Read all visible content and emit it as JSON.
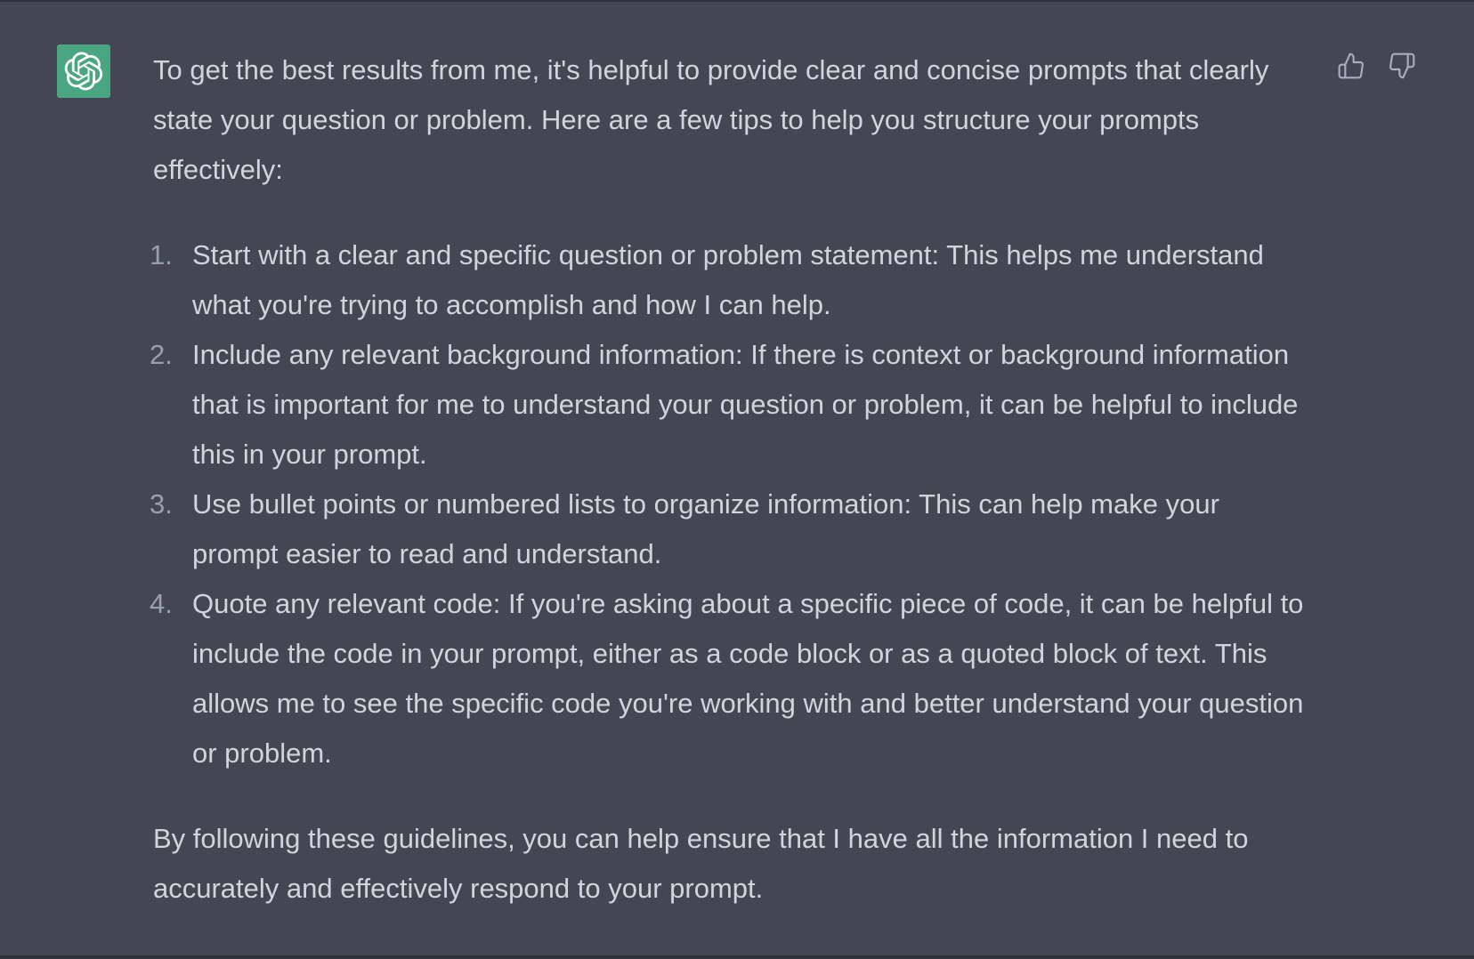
{
  "conversation": {
    "assistant": {
      "avatar_icon": "openai-logo-icon",
      "avatar_color": "#4aa582",
      "intro": "To get the best results from me, it's helpful to provide clear and concise prompts that clearly state your question or problem. Here are a few tips to help you structure your prompts effectively:",
      "tips": [
        {
          "number": "1.",
          "text": "Start with a clear and specific question or problem statement: This helps me understand what you're trying to accomplish and how I can help."
        },
        {
          "number": "2.",
          "text": "Include any relevant background information: If there is context or background information that is important for me to understand your question or problem, it can be helpful to include this in your prompt."
        },
        {
          "number": "3.",
          "text": "Use bullet points or numbered lists to organize information: This can help make your prompt easier to read and understand."
        },
        {
          "number": "4.",
          "text": "Quote any relevant code: If you're asking about a specific piece of code, it can be helpful to include the code in your prompt, either as a code block or as a quoted block of text. This allows me to see the specific code you're working with and better understand your question or problem."
        }
      ],
      "conclusion": "By following these guidelines, you can help ensure that I have all the information I need to accurately and effectively respond to your prompt."
    },
    "feedback": {
      "thumbs_up_icon": "thumbs-up-icon",
      "thumbs_down_icon": "thumbs-down-icon"
    }
  },
  "colors": {
    "background": "#444654",
    "text": "#d1d5db",
    "list_number": "#9aa0ab",
    "icon": "#acacbe"
  }
}
